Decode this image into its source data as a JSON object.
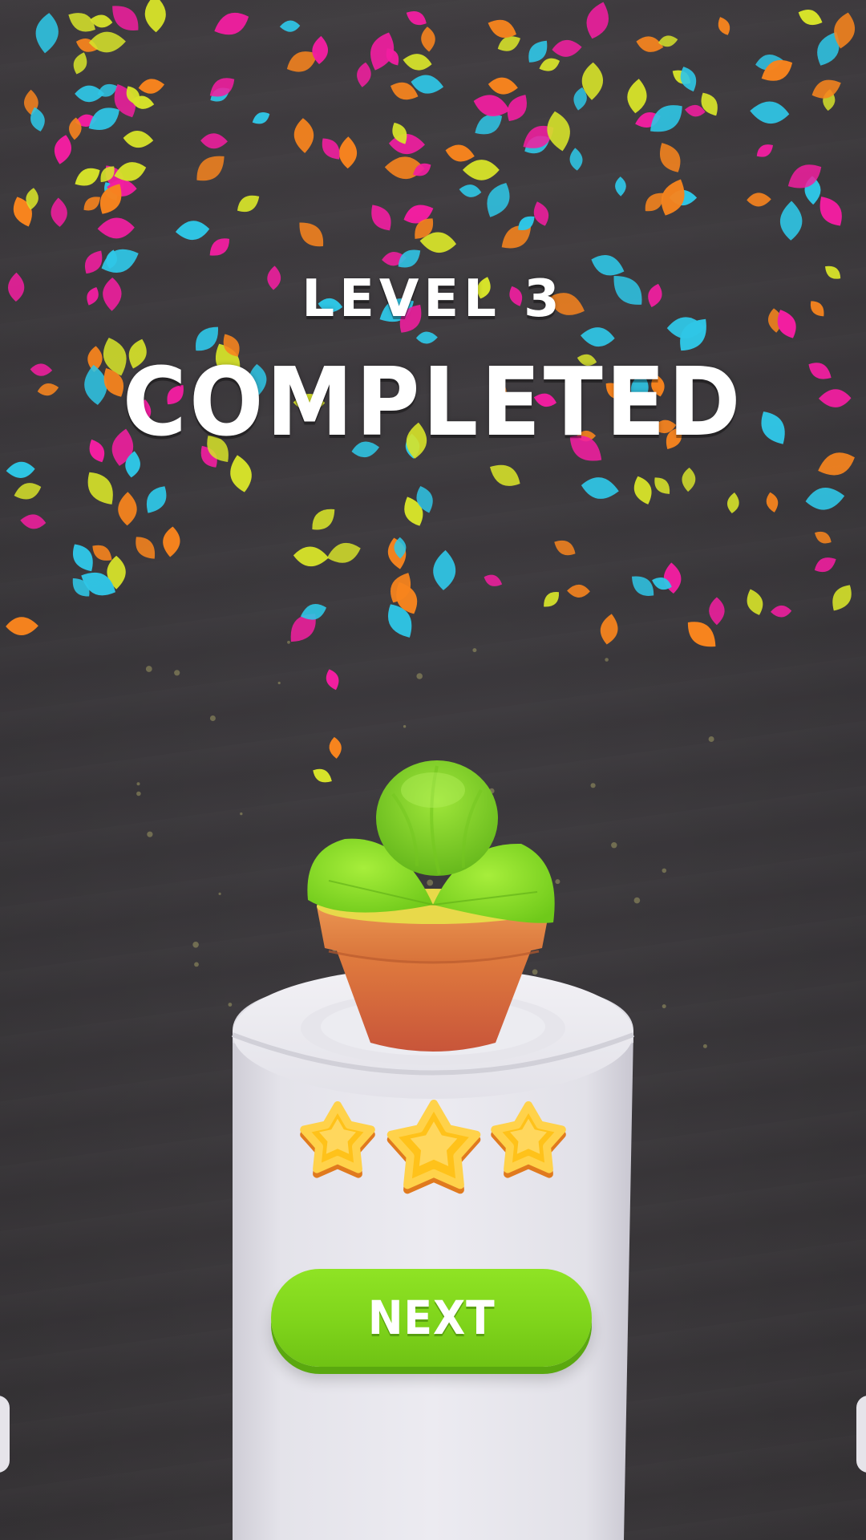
{
  "level_complete": {
    "level_label": "LEVEL 3",
    "status_label": "COMPLETED",
    "stars_earned": 3,
    "stars_total": 3,
    "next_button_label": "NEXT"
  },
  "colors": {
    "background": "#3f3c40",
    "confetti": [
      "#f7841e",
      "#2fc6e6",
      "#f21ea0",
      "#d6e22a"
    ],
    "button": "#80d61b",
    "star": "#ffc21a",
    "pot": "#d9743a",
    "leaf": "#8fe026",
    "pedestal": "#e9e8ee"
  }
}
